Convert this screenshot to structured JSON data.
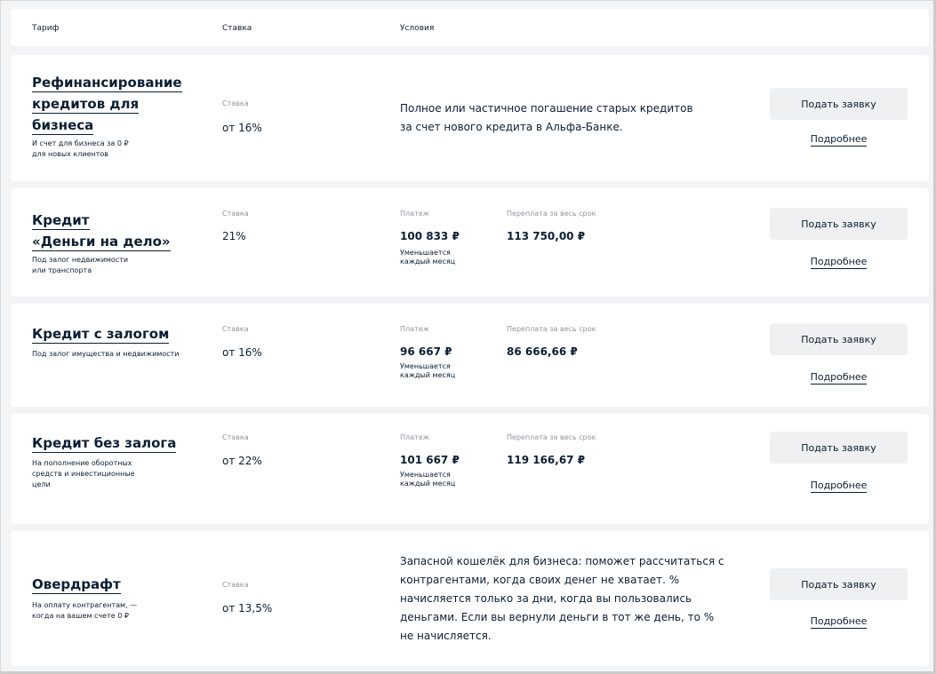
{
  "header": {
    "col_tariff": "Тариф",
    "col_rate": "Ставка",
    "col_conditions": "Условия"
  },
  "common": {
    "rate_label": "Ставка",
    "payment_label": "Платеж",
    "overpay_label": "Переплата за весь срок",
    "decrease_line1": "Уменьшается",
    "decrease_line2": "каждый месяц",
    "apply_label": "Подать заявку",
    "more_label": "Подробнее"
  },
  "tariffs": [
    {
      "title_lines": [
        "Рефинансирование",
        "кредитов для",
        "бизнеса"
      ],
      "sub_lines": [
        "И счет для бизнеса за 0 ₽",
        "для новых клиентов"
      ],
      "rate": "от 16%",
      "conditions_lines": [
        "Полное или частичное погашение старых кредитов",
        "за счет нового кредита в Альфа-Банке."
      ]
    },
    {
      "title_lines": [
        "Кредит",
        "«Деньги на дело»"
      ],
      "sub_lines": [
        "Под залог недвижимости",
        "или транспорта"
      ],
      "rate": "21%",
      "payment": "100 833 ₽",
      "overpay": "113 750,00 ₽"
    },
    {
      "title_lines": [
        "Кредит с залогом"
      ],
      "sub_lines": [
        "Под залог имущества и недвижимости"
      ],
      "rate": "от 16%",
      "payment": "96 667 ₽",
      "overpay": "86 666,66 ₽"
    },
    {
      "title_lines": [
        "Кредит без залога"
      ],
      "sub_lines": [
        "На пополнение оборотных",
        "средств и инвестиционные",
        "цели"
      ],
      "rate": "от 22%",
      "payment": "101 667 ₽",
      "overpay": "119 166,67 ₽"
    },
    {
      "title_lines": [
        "Овердрафт"
      ],
      "sub_lines": [
        "На оплату контрагентам, —",
        "когда на вашем счете 0 ₽"
      ],
      "rate": "от 13,5%",
      "conditions_lines": [
        "Запасной кошелёк для бизнеса: поможет рассчитаться с",
        "контрагентами, когда своих денег не хватает. %",
        "начисляется только за дни, когда вы пользовались",
        "деньгами. Если вы вернули деньги в тот же день, то %",
        "не начисляется."
      ]
    }
  ]
}
